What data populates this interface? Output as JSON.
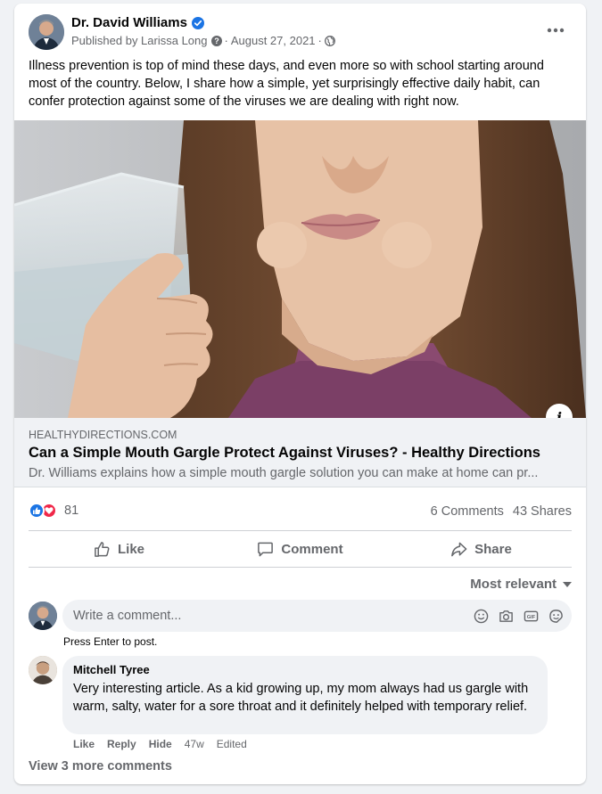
{
  "post": {
    "author": "Dr. David Williams",
    "published_by": "Published by Larissa Long",
    "date": "August 27, 2021",
    "text": "Illness prevention is top of mind these days, and even more so with school starting around most of the country. Below, I share how a simple, yet surprisingly effective daily habit, can confer protection against some of the viruses we are dealing with right now."
  },
  "link_preview": {
    "domain": "HEALTHYDIRECTIONS.COM",
    "title": "Can a Simple Mouth Gargle Protect Against Viruses? - Healthy Directions",
    "description": "Dr. Williams explains how a simple mouth gargle solution you can make at home can pr..."
  },
  "stats": {
    "reaction_count": "81",
    "comments": "6 Comments",
    "shares": "43 Shares"
  },
  "actions": {
    "like": "Like",
    "comment": "Comment",
    "share": "Share"
  },
  "comments_section": {
    "sort_label": "Most relevant",
    "composer_placeholder": "Write a comment...",
    "hint": "Press Enter to post.",
    "view_more": "View 3 more comments"
  },
  "comment": {
    "author": "Mitchell Tyree",
    "text": "Very interesting article. As a kid growing up, my mom always had us gargle with warm, salty, water for a sore throat and it definitely helped with temporary relief.",
    "like": "Like",
    "reply": "Reply",
    "hide": "Hide",
    "age": "47w",
    "edited": "Edited"
  },
  "colors": {
    "accent": "#1b74e4",
    "love": "#f02849",
    "secondary_text": "#65676b",
    "page_background": "#f0f2f5"
  },
  "icons": [
    "verified-badge-icon",
    "privacy-globe-icon",
    "more-options-icon",
    "info-icon",
    "like-reaction-icon",
    "love-reaction-icon",
    "thumbs-up-icon",
    "comment-icon",
    "share-icon",
    "emoji-icon",
    "camera-icon",
    "gif-icon",
    "sticker-icon"
  ]
}
